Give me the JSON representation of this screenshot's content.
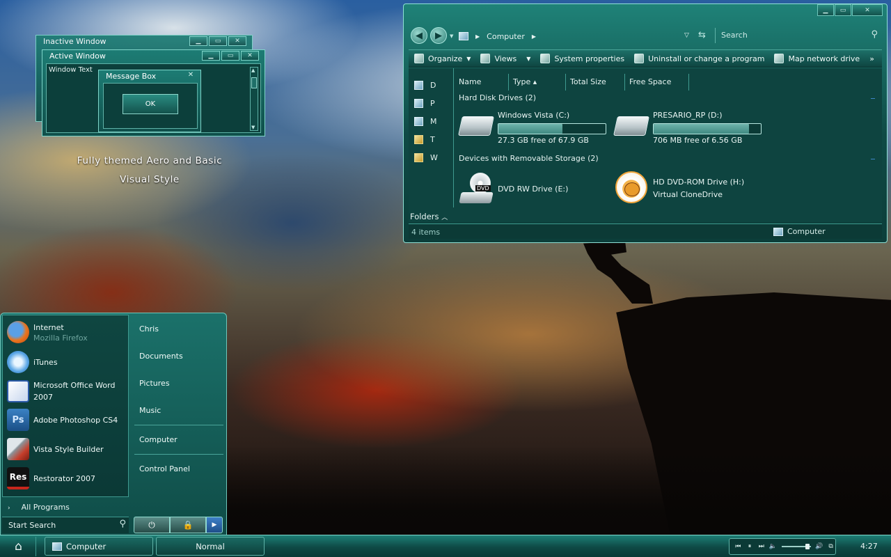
{
  "desktop": {
    "tagline_line1": "Fully themed Aero and Basic",
    "tagline_line2": "Visual Style"
  },
  "preview": {
    "inactive_title": "Inactive Window",
    "active_title": "Active Window",
    "window_text": "Window Text",
    "message_box_title": "Message Box",
    "ok_label": "OK"
  },
  "explorer": {
    "breadcrumb": "Computer",
    "search_placeholder": "Search",
    "toolbar": {
      "organize": "Organize",
      "views": "Views",
      "system_properties": "System properties",
      "uninstall": "Uninstall or change a program",
      "map_drive": "Map network drive",
      "more": "»"
    },
    "nav_items": [
      "D",
      "P",
      "M",
      "T",
      "W"
    ],
    "columns": [
      "Name",
      "Type",
      "Total Size",
      "Free Space"
    ],
    "groups": {
      "hdd": "Hard Disk Drives (2)",
      "removable": "Devices with Removable Storage (2)"
    },
    "drives": [
      {
        "name": "Windows Vista (C:)",
        "free_text": "27.3 GB free of 67.9 GB",
        "used_fraction": 0.6
      },
      {
        "name": "PRESARIO_RP (D:)",
        "free_text": "706 MB free of 6.56 GB",
        "used_fraction": 0.89
      }
    ],
    "removable": [
      {
        "name": "DVD RW Drive (E:)",
        "icon_label": "DVD"
      },
      {
        "name": "HD DVD-ROM Drive (H:)",
        "sub": "Virtual CloneDrive"
      }
    ],
    "folders_label": "Folders",
    "status_items": "4 items",
    "status_location": "Computer"
  },
  "start_menu": {
    "pinned": [
      {
        "label": "Internet",
        "sub": "Mozilla Firefox",
        "icon": "firefox-icon"
      },
      {
        "label": "iTunes",
        "icon": "itunes-icon"
      },
      {
        "label": "Microsoft Office Word",
        "label2": "2007",
        "icon": "word-icon"
      },
      {
        "label": "Adobe Photoshop CS4",
        "icon": "photoshop-icon"
      },
      {
        "label": "Vista Style Builder",
        "icon": "vista-style-builder-icon"
      },
      {
        "label": "Restorator 2007",
        "icon": "restorator-icon"
      }
    ],
    "ps_text": "Ps",
    "res_text": "Res",
    "all_programs": "All Programs",
    "search_placeholder": "Start Search",
    "places": [
      "Chris",
      "Documents",
      "Pictures",
      "Music",
      "Computer",
      "Control Panel"
    ]
  },
  "taskbar": {
    "buttons": [
      "Computer",
      "Normal"
    ],
    "clock": "4:27"
  }
}
